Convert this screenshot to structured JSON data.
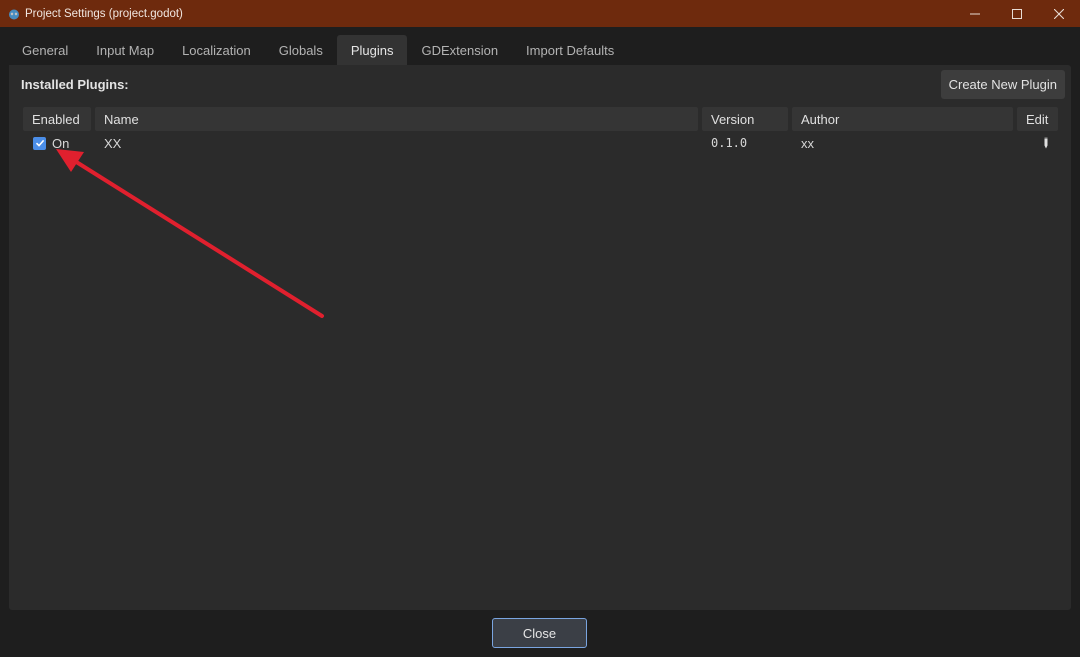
{
  "window": {
    "title": "Project Settings (project.godot)",
    "controls": {
      "minimize": "—",
      "maximize": "☐",
      "close": "✕"
    }
  },
  "tabs": [
    {
      "label": "General",
      "active": false
    },
    {
      "label": "Input Map",
      "active": false
    },
    {
      "label": "Localization",
      "active": false
    },
    {
      "label": "Globals",
      "active": false
    },
    {
      "label": "Plugins",
      "active": true
    },
    {
      "label": "GDExtension",
      "active": false
    },
    {
      "label": "Import Defaults",
      "active": false
    }
  ],
  "plugins": {
    "header": "Installed Plugins:",
    "create_button": "Create New Plugin",
    "columns": [
      "Enabled",
      "Name",
      "Version",
      "Author",
      "Edit"
    ],
    "rows": [
      {
        "enabled": true,
        "enabled_label": "On",
        "name": "XX",
        "version": "0.1.0",
        "author": "xx",
        "edit_icon": "pencil-icon"
      }
    ]
  },
  "footer": {
    "close_button": "Close"
  },
  "colors": {
    "titlebar": "#6e2a0d",
    "accent": "#4b8ee8",
    "annotation_arrow": "#e0202e"
  }
}
